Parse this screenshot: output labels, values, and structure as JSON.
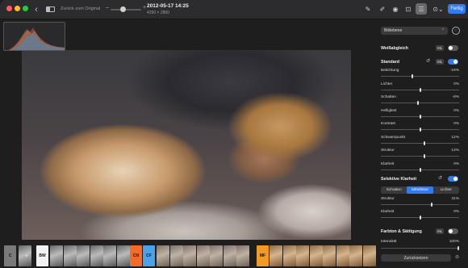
{
  "toolbar": {
    "revert_label": "Zurück zum Original",
    "date": "2012-05-17 14:25",
    "resolution": "4290 × 2860",
    "done_label": "Fertig"
  },
  "panel": {
    "layer_dropdown": "Bildebene",
    "white_balance": {
      "label": "Weißabgleich",
      "badge": "ML",
      "enabled": false
    },
    "standard": {
      "label": "Standard",
      "badge": "ML",
      "enabled": true
    },
    "sliders": [
      {
        "label": "Belichtung",
        "value": "-19%",
        "pos": 0.4
      },
      {
        "label": "Lichter",
        "value": "0%",
        "pos": 0.5
      },
      {
        "label": "Schatten",
        "value": "-6%",
        "pos": 0.47
      },
      {
        "label": "Helligkeit",
        "value": "0%",
        "pos": 0.5
      },
      {
        "label": "Kontrast",
        "value": "0%",
        "pos": 0.5
      },
      {
        "label": "Schwarzpunkt",
        "value": "12%",
        "pos": 0.56
      },
      {
        "label": "Struktur",
        "value": "13%",
        "pos": 0.56
      },
      {
        "label": "Klarheit",
        "value": "0%",
        "pos": 0.5
      }
    ],
    "selective": {
      "label": "Selektive Klarheit",
      "enabled": true
    },
    "segments": [
      "Schatten",
      "Mitteltöne",
      "Lichter"
    ],
    "segment_active": 1,
    "sel_sliders": [
      {
        "label": "Struktur",
        "value": "31%",
        "pos": 0.65
      },
      {
        "label": "Klarheit",
        "value": "0%",
        "pos": 0.5
      }
    ],
    "color": {
      "label": "Farbton & Sättigung",
      "badge": "ML",
      "enabled": false
    },
    "intensity": {
      "label": "Intensität",
      "value": "100%"
    },
    "reset_all": "Zurücksetzen"
  },
  "filmstrip": {
    "tags": [
      {
        "text": "C",
        "bg": "#7a7a7a",
        "fg": "#111"
      },
      {
        "text": "BW",
        "bg": "#f2f2f2",
        "fg": "#111"
      },
      {
        "text": "CN",
        "bg": "#f46b29",
        "fg": "#111"
      },
      {
        "text": "CF",
        "bg": "#4aa3e8",
        "fg": "#111"
      },
      {
        "text": "MF",
        "bg": "#f39a23",
        "fg": "#111"
      }
    ]
  },
  "colors": {
    "accent": "#2f7cf6"
  }
}
